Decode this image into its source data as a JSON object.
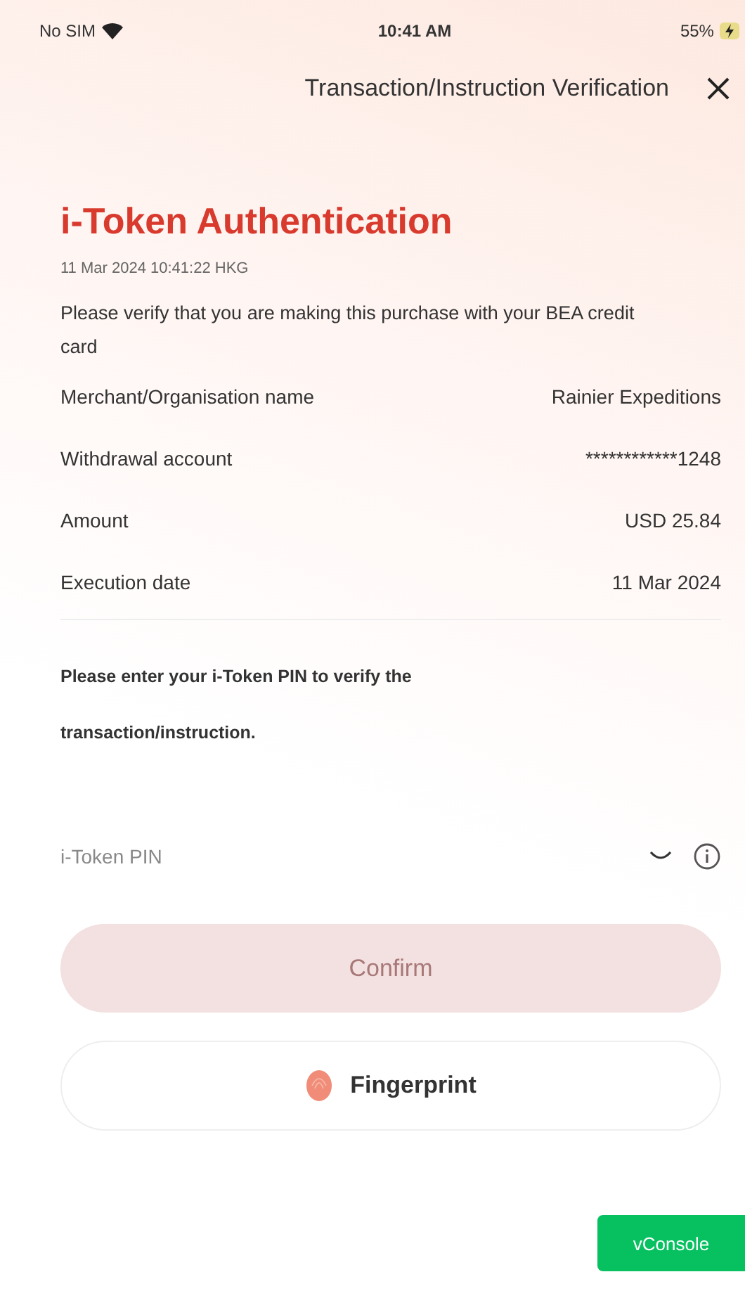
{
  "status_bar": {
    "carrier": "No SIM",
    "time": "10:41 AM",
    "battery": "55%"
  },
  "header": {
    "title": "Transaction/Instruction Verification"
  },
  "heading": "i-Token Authentication",
  "timestamp": "11 Mar 2024 10:41:22 HKG",
  "intro": "Please verify that you are making this purchase with your BEA credit card",
  "details": [
    {
      "label": "Merchant/Organisation name",
      "value": "Rainier Expeditions"
    },
    {
      "label": "Withdrawal account",
      "value": "************1248"
    },
    {
      "label": "Amount",
      "value": "USD 25.84"
    },
    {
      "label": "Execution date",
      "value": "11 Mar 2024"
    }
  ],
  "instruction": "Please enter your i-Token PIN to verify the transaction/instruction.",
  "pin_field": {
    "placeholder": "i-Token PIN"
  },
  "confirm_button": {
    "label": "Confirm",
    "disabled": true
  },
  "fingerprint_button": {
    "label": "Fingerprint"
  },
  "vconsole_button": {
    "label": "vConsole"
  }
}
